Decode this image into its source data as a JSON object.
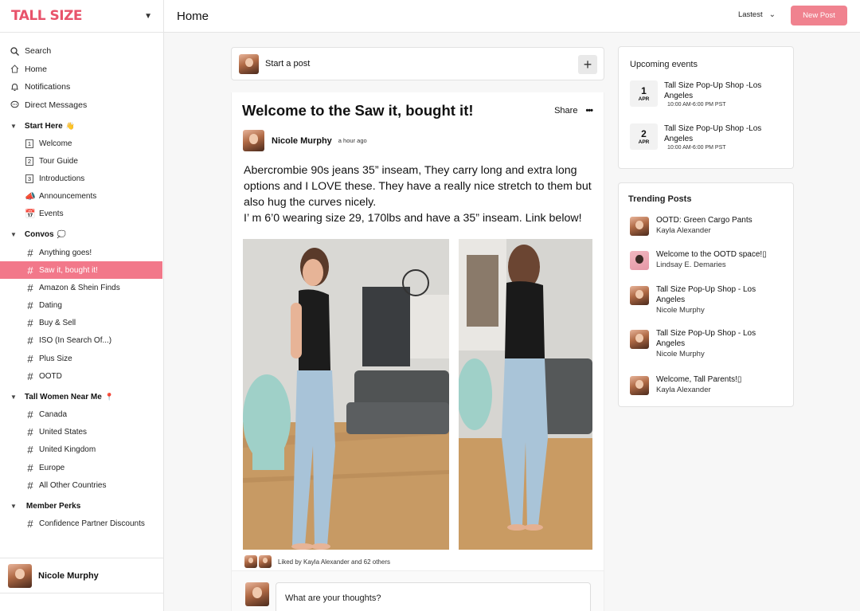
{
  "brand": {
    "logo_text": "TALL SIZE",
    "accent": "#e8536b"
  },
  "nav": [
    {
      "label": "Search",
      "icon": "search-icon"
    },
    {
      "label": "Home",
      "icon": "home-icon"
    },
    {
      "label": "Notifications",
      "icon": "bell-icon"
    },
    {
      "label": "Direct Messages",
      "icon": "chat-icon"
    }
  ],
  "sections": {
    "start_here": {
      "title": "Start Here",
      "items": [
        {
          "label": "Welcome",
          "num": "1"
        },
        {
          "label": "Tour Guide",
          "num": "2"
        },
        {
          "label": "Introductions",
          "num": "3"
        },
        {
          "label": "Announcements",
          "icon": "megaphone-icon"
        },
        {
          "label": "Events",
          "icon": "calendar-icon"
        }
      ]
    },
    "convos": {
      "title": "Convos",
      "items": [
        "Anything goes!",
        "Saw it, bought it!",
        "Amazon & Shein Finds",
        "Dating",
        "Buy & Sell",
        "ISO (In Search Of...)",
        "Plus Size",
        "OOTD"
      ]
    },
    "near_me": {
      "title": "Tall Women Near Me",
      "items": [
        "Canada",
        "United States",
        "United Kingdom",
        "Europe",
        "All Other Countries"
      ]
    },
    "perks": {
      "title": "Member Perks",
      "items": [
        "Confidence Partner Discounts"
      ]
    }
  },
  "user": {
    "name": "Nicole Murphy"
  },
  "header": {
    "title": "Home",
    "sort": "Lastest",
    "new_post": "New Post"
  },
  "composer": {
    "placeholder": "Start a post"
  },
  "post": {
    "title": "Welcome to the Saw it, bought it!",
    "share": "Share",
    "author": "Nicole Murphy",
    "time": "a hour ago",
    "body_1": "Abercrombie 90s jeans 35” inseam, They carry long and extra long options and I LOVE these. They have a really nice stretch to them but also hug the curves nicely.",
    "body_2": "I’ m 6’0 wearing size 29, 170lbs and have a 35” inseam. Link below!",
    "liked": "Liked by Kayla Alexander and 62 others",
    "comment_placeholder": "What are your thoughts?"
  },
  "events": {
    "title": "Upcoming events",
    "list": [
      {
        "day": "1",
        "month": "APR",
        "title": "Tall Size Pop-Up Shop -Los Angeles",
        "time": "10:00 AM-6:00 PM PST"
      },
      {
        "day": "2",
        "month": "APR",
        "title": "Tall Size Pop-Up Shop -Los Angeles",
        "time": "10:00 AM-6:00 PM PST"
      }
    ]
  },
  "trending": {
    "title": "Trending Posts",
    "list": [
      {
        "title": "OOTD: Green Cargo Pants",
        "author": "Kayla Alexander"
      },
      {
        "title": "Welcome to the OOTD space!▯",
        "author": "Lindsay E. Demaries"
      },
      {
        "title": "Tall Size Pop-Up Shop - Los Angeles",
        "author": "Nicole Murphy"
      },
      {
        "title": "Tall Size Pop-Up Shop - Los Angeles",
        "author": "Nicole Murphy"
      },
      {
        "title": "Welcome, Tall Parents!▯",
        "author": "Kayla Alexander"
      }
    ]
  }
}
